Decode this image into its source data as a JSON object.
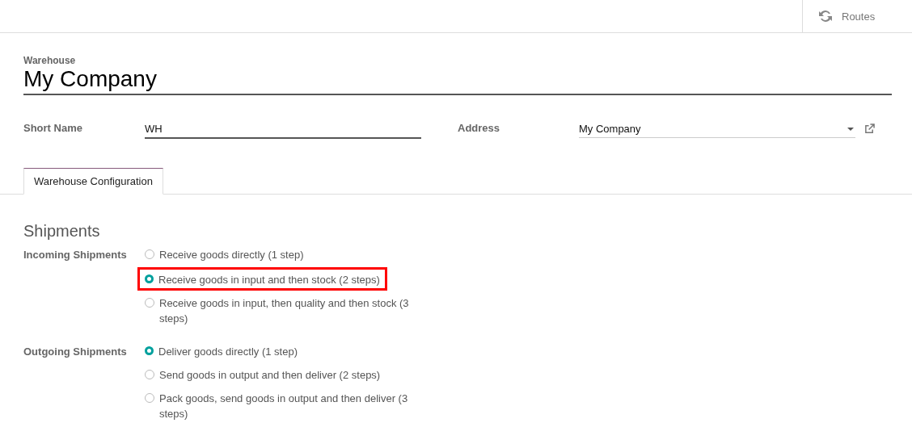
{
  "top_bar": {
    "routes_button": "Routes"
  },
  "form": {
    "title_label": "Warehouse",
    "title": "My Company",
    "fields": [
      {
        "label": "Short Name",
        "value": "WH",
        "kind": "text"
      },
      {
        "label": "Address",
        "value": "My Company",
        "kind": "many2one"
      }
    ]
  },
  "tabs": [
    {
      "label": "Warehouse Configuration",
      "selected": true
    }
  ],
  "section": {
    "title": "Shipments",
    "groups": [
      {
        "label": "Incoming Shipments",
        "options": [
          {
            "label": "Receive goods directly (1 step)",
            "selected": false,
            "highlighted": false
          },
          {
            "label": "Receive goods in input and then stock (2 steps)",
            "selected": true,
            "highlighted": true
          },
          {
            "label": "Receive goods in input, then quality and then stock (3 steps)",
            "selected": false,
            "highlighted": false
          }
        ]
      },
      {
        "label": "Outgoing Shipments",
        "options": [
          {
            "label": "Deliver goods directly (1 step)",
            "selected": true,
            "highlighted": false
          },
          {
            "label": "Send goods in output and then deliver (2 steps)",
            "selected": false,
            "highlighted": false
          },
          {
            "label": "Pack goods, send goods in output and then deliver (3 steps)",
            "selected": false,
            "highlighted": false
          }
        ]
      }
    ]
  }
}
